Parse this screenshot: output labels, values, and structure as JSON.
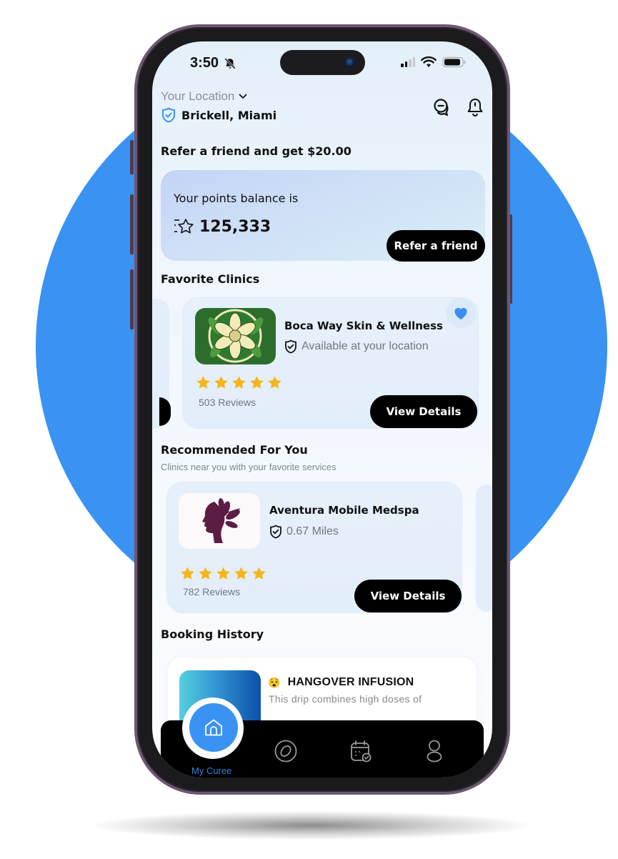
{
  "status_bar": {
    "time": "3:50",
    "icons": [
      "bell-slash-icon",
      "signal-icon",
      "wifi-icon",
      "battery-icon"
    ]
  },
  "header": {
    "location_label": "Your Location",
    "location_value": "Brickell, Miami",
    "icons": [
      "chat-icon",
      "bell-icon"
    ]
  },
  "referral": {
    "title": "Refer a friend and get $20.00",
    "points_label": "Your points balance is",
    "points_value": "125,333",
    "button_label": "Refer a friend"
  },
  "favorite_clinics": {
    "title": "Favorite Clinics",
    "items": [
      {
        "name": "Boca Way Skin & Wellness",
        "availability": "Available at your location",
        "rating": 5,
        "reviews": "503 Reviews",
        "favorited": true,
        "button_label": "View Details"
      }
    ]
  },
  "recommended": {
    "title": "Recommended For You",
    "subtitle": "Clinics near you with your favorite services",
    "items": [
      {
        "name": "Aventura Mobile Medspa",
        "distance": "0.67 Miles",
        "rating": 5,
        "reviews": "782 Reviews",
        "button_label": "View Details"
      }
    ]
  },
  "booking_history": {
    "title": "Booking History",
    "items": [
      {
        "emoji": "😵",
        "title": "HANGOVER INFUSION",
        "description": "This drip combines high doses of"
      }
    ]
  },
  "tab_bar": {
    "active_label": "My Curee",
    "tabs": [
      "home-icon",
      "explore-icon",
      "calendar-icon",
      "profile-icon"
    ]
  },
  "colors": {
    "accent": "#3a93f2",
    "star": "#f7b51c",
    "button": "#000000"
  }
}
